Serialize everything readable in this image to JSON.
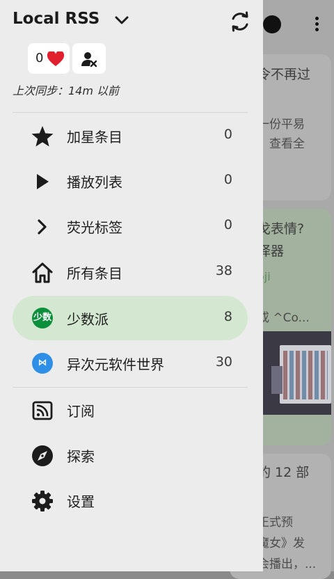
{
  "app": {
    "title": "Local RSS"
  },
  "stats": {
    "liked_count": "0"
  },
  "sync": {
    "status": "上次同步：14m 以前"
  },
  "nav": [
    {
      "label": "加星条目",
      "count": "0",
      "icon": "star-icon"
    },
    {
      "label": "播放列表",
      "count": "0",
      "icon": "play-icon"
    },
    {
      "label": "荧光标签",
      "count": "0",
      "icon": "chevron-right-icon"
    },
    {
      "label": "所有条目",
      "count": "38",
      "icon": "home-icon"
    }
  ],
  "feeds": [
    {
      "label": "少数派",
      "count": "8",
      "avatar_text": "少数",
      "color": "#0b8f3a",
      "active": true
    },
    {
      "label": "异次元软件世界",
      "count": "30",
      "avatar_text": "⋈",
      "color": "#2f8fe6",
      "active": false
    }
  ],
  "actions": [
    {
      "label": "订阅",
      "icon": "rss-icon"
    },
    {
      "label": "探索",
      "icon": "compass-icon"
    },
    {
      "label": "设置",
      "icon": "gear-icon"
    }
  ],
  "background_feed": {
    "card1": {
      "title_fragment": "令不再过",
      "line1": "一份平易",
      "line2": "，查看全"
    },
    "card2": {
      "title1": "戈表情?",
      "title2": "译器",
      "source": "oji",
      "snippet": "或 ^Co..."
    },
    "card3": {
      "title": "的 12 部",
      "line1": "正式预",
      "line2": "魔女》发",
      "line3": "会播出，..."
    }
  },
  "colors": {
    "active_bg": "#d4e8d1",
    "drawer_bg": "#ececec",
    "heart": "#e0202f"
  }
}
